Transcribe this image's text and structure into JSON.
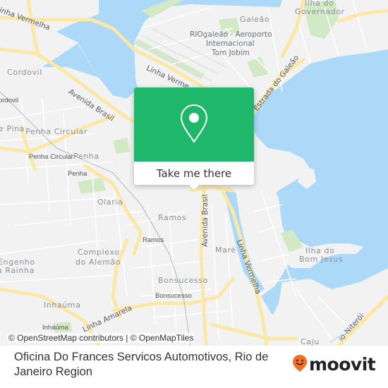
{
  "map": {
    "colors": {
      "land": "#f2f2f3",
      "water": "#acd9f7",
      "park": "#d2e9c6",
      "major_road": "#fbe8a6",
      "minor_road": "#ffffff",
      "popup_green": "#1fb86a",
      "moovit_orange": "#f36f21"
    },
    "area_labels": [
      {
        "id": "galeao",
        "text": "Galeão"
      },
      {
        "id": "ilha-governador-1",
        "text": "Ilha do"
      },
      {
        "id": "ilha-governador-2",
        "text": "Governador"
      },
      {
        "id": "cordovil",
        "text": "Cordovil"
      },
      {
        "id": "penha-circular",
        "text": "Penha Circular"
      },
      {
        "id": "penha",
        "text": "Penha"
      },
      {
        "id": "de-pina",
        "text": "e Pina"
      },
      {
        "id": "olaria",
        "text": "Olaria"
      },
      {
        "id": "ramos",
        "text": "Ramos"
      },
      {
        "id": "complexo-1",
        "text": "Complexo"
      },
      {
        "id": "complexo-2",
        "text": "do Alemão"
      },
      {
        "id": "engenho-1",
        "text": "Engenho"
      },
      {
        "id": "engenho-2",
        "text": "a Rainha"
      },
      {
        "id": "bonsucesso",
        "text": "Bonsucesso"
      },
      {
        "id": "inhauma",
        "text": "Inhaúma"
      },
      {
        "id": "mare",
        "text": "Maré"
      },
      {
        "id": "bom-jesus-1",
        "text": "Ilha do"
      },
      {
        "id": "bom-jesus-2",
        "text": "Bom Jesus"
      },
      {
        "id": "caju",
        "text": "Caju"
      }
    ],
    "station_labels": [
      {
        "id": "cordovil-st",
        "text": "ordovil"
      },
      {
        "id": "penha-circular-st",
        "text": "Penha Circular"
      },
      {
        "id": "penha-st",
        "text": "Penha"
      },
      {
        "id": "ramos-st",
        "text": "Ramos"
      },
      {
        "id": "bonsucesso-st",
        "text": "Bonsucesso"
      },
      {
        "id": "inhauma-st",
        "text": "Inhaúma"
      }
    ],
    "poi_labels": [
      {
        "id": "airport-1",
        "text": "RIOgaleão - Aeroporto"
      },
      {
        "id": "airport-2",
        "text": "Internacional"
      },
      {
        "id": "airport-3",
        "text": "Tom Jobim"
      }
    ],
    "road_labels": [
      {
        "id": "linha-vermelha-top",
        "text": "Linha Vermelha"
      },
      {
        "id": "linha-vermelha-mid",
        "text": "Linha Verme"
      },
      {
        "id": "avenida-brasil-nw",
        "text": "Avenida Brasil"
      },
      {
        "id": "estrada-galeao",
        "text": "Estrada do Galeão"
      },
      {
        "id": "avenida-brasil-c",
        "text": "Avenida Brasil"
      },
      {
        "id": "linha-vermelha-se",
        "text": "Linha Vermelha"
      },
      {
        "id": "linha-amarela",
        "text": "Linha Amarela"
      },
      {
        "id": "rio-niteroi",
        "text": "io-Niterói"
      }
    ],
    "attribution": "© OpenStreetMap contributors | © OpenMapTiles"
  },
  "popup": {
    "icon": "map-pin-icon",
    "button_label": "Take me there"
  },
  "footer": {
    "title": "Oficina Do Frances Servicos Automotivos, Rio de Janeiro Region",
    "logo_text": "moovit",
    "logo_icon": "moovit-pin-smile-icon"
  }
}
